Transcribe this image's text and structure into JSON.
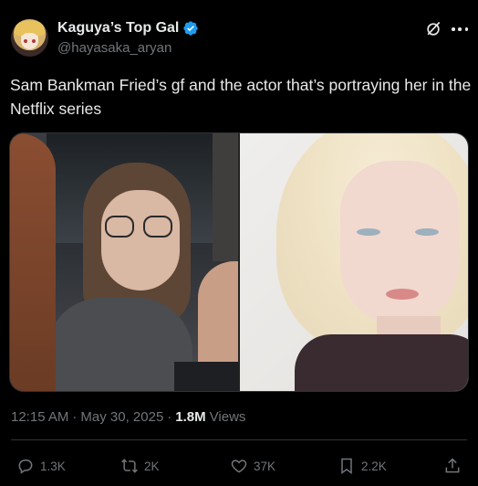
{
  "author": {
    "display_name": "Kaguya’s Top Gal",
    "handle": "@hayasaka_aryan",
    "verified": true
  },
  "tweet": {
    "text": "Sam Bankman Fried’s gf and the actor that’s portraying her in the Netflix series"
  },
  "meta": {
    "time": "12:15 AM",
    "separator": "·",
    "date": "May 30, 2025",
    "separator2": "·",
    "views_count": "1.8M",
    "views_label": "Views"
  },
  "actions": {
    "replies": "1.3K",
    "reposts": "2K",
    "likes": "37K",
    "bookmarks": "2.2K"
  },
  "colors": {
    "background": "#000000",
    "text": "#e7e9ea",
    "muted": "#71767b",
    "verified": "#1d9bf0",
    "border": "#2f3336"
  },
  "icons": [
    "grok-icon",
    "more-icon",
    "verified-icon",
    "reply-icon",
    "repost-icon",
    "like-icon",
    "bookmark-icon",
    "share-icon"
  ]
}
